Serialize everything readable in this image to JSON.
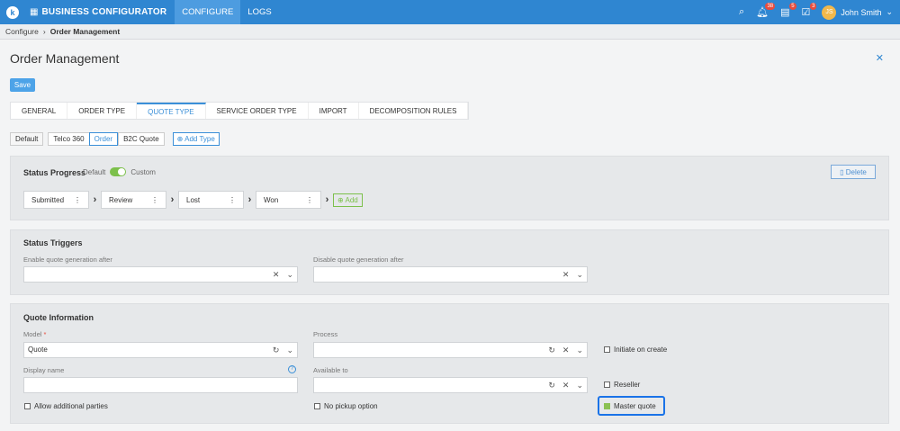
{
  "topbar": {
    "logo": "k",
    "app_name": "BUSINESS CONFIGURATOR",
    "nav": [
      "CONFIGURE",
      "LOGS"
    ],
    "badges": {
      "notifications": "38",
      "tasks": "5",
      "approvals": "3"
    },
    "user_initials": "JS",
    "user_name": "John Smith"
  },
  "breadcrumb": {
    "root": "Configure",
    "current": "Order Management"
  },
  "page": {
    "title": "Order Management",
    "save_label": "Save"
  },
  "tabs": [
    "GENERAL",
    "ORDER TYPE",
    "QUOTE TYPE",
    "SERVICE ORDER TYPE",
    "IMPORT",
    "DECOMPOSITION RULES"
  ],
  "subtypes": {
    "items": [
      "Default",
      "Telco 360",
      "Order",
      "B2C Quote"
    ],
    "add_label": "Add Type"
  },
  "status_progress": {
    "title": "Status Progress",
    "toggle_left": "Default",
    "toggle_right": "Custom",
    "delete_label": "Delete",
    "steps": [
      "Submitted",
      "Review",
      "Lost",
      "Won"
    ],
    "add_label": "Add"
  },
  "status_triggers": {
    "title": "Status Triggers",
    "enable_label": "Enable quote generation after",
    "disable_label": "Disable quote generation after"
  },
  "quote_info": {
    "title": "Quote Information",
    "model_label": "Model",
    "model_value": "Quote",
    "process_label": "Process",
    "initiate_label": "Initiate on create",
    "display_name_label": "Display name",
    "available_to_label": "Available to",
    "reseller_label": "Reseller",
    "allow_parties_label": "Allow additional parties",
    "no_pickup_label": "No pickup option",
    "master_quote_label": "Master quote"
  },
  "colors": {
    "accent": "#2f86d1",
    "toggle_on": "#7cc04b",
    "check": "#8cc152",
    "highlight": "#1a73e8"
  }
}
